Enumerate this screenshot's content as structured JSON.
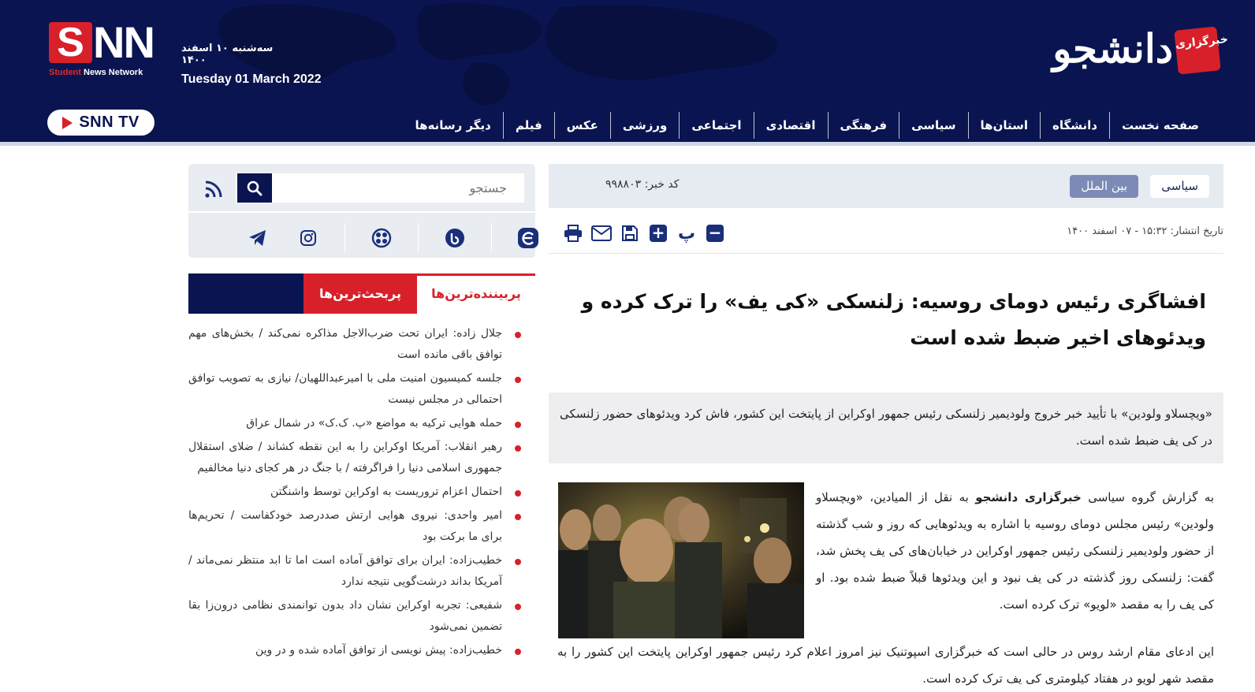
{
  "header": {
    "snn_logo": {
      "letter": "S",
      "rest": "NN",
      "tag_red": "Student",
      "tag_white": "News Network"
    },
    "date_fa": "سه‌شنبه ۱۰ اسفند ۱۴۰۰",
    "date_en": "Tuesday 01 March 2022",
    "brand_name": "دانشجو",
    "brand_badge": "خبرگزاری",
    "snn_tv": "SNN TV",
    "nav": [
      "صفحه نخست",
      "دانشگاه",
      "استان‌ها",
      "سیاسی",
      "فرهنگی",
      "اقتصادی",
      "اجتماعی",
      "ورزشی",
      "عکس",
      "فیلم",
      "دیگر رسانه‌ها"
    ]
  },
  "article": {
    "category_1": "سیاسی",
    "category_2": "بین الملل",
    "news_code": "کد خبر: ۹۹۸۸۰۳",
    "pub_date": "تاریخ انتشار: ۱۵:۳۲ - ۰۷ اسفند ۱۴۰۰",
    "tools": {
      "pe": "پ"
    },
    "headline": "افشاگری رئیس دومای روسیه: زلنسکی «کی یف» را ترک کرده و ویدئوهای اخیر ضبط شده است",
    "lead": "«ویچسلاو ولودین» با تأیید خبر خروج ولودیمیر زلنسکی رئیس جمهور اوکراین از پایتخت این کشور، فاش کرد ویدئوهای حضور زلنسکی در کی یف ضبط شده است.",
    "body_p1_prefix": "به گزارش گروه سیاسی ",
    "body_p1_bold": "خبرگزاری دانشجو",
    "body_p1_rest": " به نقل از المیادین، «ویچسلاو ولودین» رئیس مجلس دومای روسیه با اشاره به ویدئوهایی که روز و شب گذشته از حضور ولودیمیر زلنسکی رئیس جمهور اوکراین در خیابان‌های کی یف پخش شد، گفت: زلنسکی روز گذشته در کی یف نبود و این ویدئوها قبلاً ضبط شده بود. او کی یف را به مقصد «لویو» ترک کرده است.",
    "body_p2": "این ادعای مقام ارشد روس در حالی است که خبرگزاری اسپوتنیک نیز امروز اعلام کرد رئیس جمهور اوکراین پایتخت این کشور را به مقصد شهر لویو در هفتاد کیلومتری کی یف ترک کرده است."
  },
  "sidebar": {
    "search_placeholder": "جستجو",
    "tab_most_viewed": "پربیننده‌ترین‌ها",
    "tab_most_discussed": "پربحث‌ترین‌ها",
    "items": [
      "جلال زاده: ایران تحت ضرب‌الاجل مذاکره نمی‌کند / بخش‌های مهم توافق باقی مانده است",
      "جلسه کمیسیون امنیت ملی با امیرعبداللهیان/ نیازی به تصویب توافق احتمالی در مجلس نیست",
      "حمله هوایی ترکیه به مواضع «پ. ک.ک» در شمال عراق",
      "رهبر انقلاب: آمریکا اوکراین را به این نقطه کشاند / ضلای استقلال جمهوری اسلامی دنیا را فراگرفته / با جنگ در هر کجای دنیا مخالفیم",
      "احتمال اعزام تروریست به اوکراین توسط واشنگتن",
      "امیر واحدی: نیروی هوایی ارتش صددرصد خودکفاست / تحریم‌ها برای ما برکت بود",
      "خطیب‌زاده: ایران برای توافق آماده است اما تا ابد منتظر نمی‌ماند / آمریکا بداند درشت‌گویی نتیجه ندارد",
      "شفیعی: تجربه اوکراین نشان داد بدون توانمندی نظامی درون‌زا بقا تضمین نمی‌شود",
      "خطیب‌زاده: پیش نویسی از توافق آماده شده و در وین"
    ]
  },
  "colors": {
    "navy": "#0a1450",
    "red": "#d8202a",
    "accent_blue": "#1a2e7a"
  }
}
